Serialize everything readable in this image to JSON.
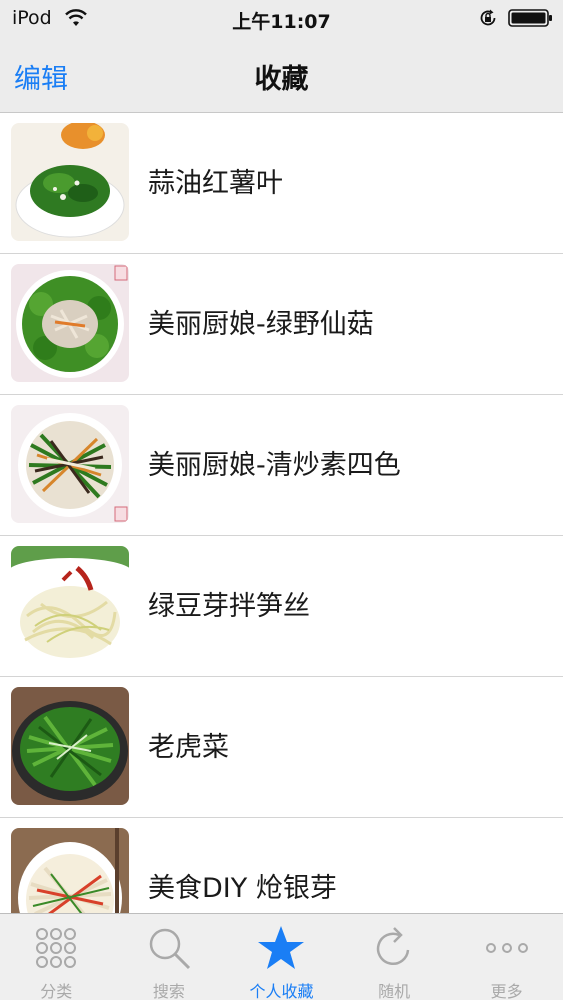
{
  "status_bar": {
    "carrier": "iPod",
    "time": "上午11:07"
  },
  "nav": {
    "edit_label": "编辑",
    "title": "收藏"
  },
  "favorites": [
    {
      "name": "蒜油红薯叶",
      "thumb_icon": "sweet-potato-leaves-photo"
    },
    {
      "name": "美丽厨娘-绿野仙菇",
      "thumb_icon": "mushroom-broccoli-photo"
    },
    {
      "name": "美丽厨娘-清炒素四色",
      "thumb_icon": "stir-fry-four-color-photo"
    },
    {
      "name": "绿豆芽拌笋丝",
      "thumb_icon": "bean-sprout-salad-photo"
    },
    {
      "name": "老虎菜",
      "thumb_icon": "tiger-salad-photo"
    },
    {
      "name": "美食DIY 炝银芽",
      "thumb_icon": "spicy-bean-sprout-photo"
    }
  ],
  "tab_bar": {
    "tabs": [
      {
        "label": "分类",
        "icon": "grid-icon"
      },
      {
        "label": "搜索",
        "icon": "search-icon"
      },
      {
        "label": "个人收藏",
        "icon": "star-icon"
      },
      {
        "label": "随机",
        "icon": "refresh-icon"
      },
      {
        "label": "更多",
        "icon": "more-icon"
      }
    ],
    "active_index": 2
  },
  "colors": {
    "accent": "#1a7ef5",
    "bar_background": "#ececec",
    "tab_inactive": "#a9a9a9"
  }
}
